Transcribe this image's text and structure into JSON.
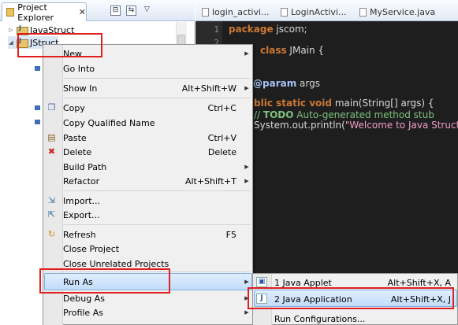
{
  "project_explorer": {
    "tab_label": "Project Explorer",
    "close_glyph": "✕",
    "projects": [
      {
        "name": "JavaStruct"
      },
      {
        "name": "JStruct"
      }
    ],
    "buttons": {
      "collapse": "⊟",
      "link": "⇆",
      "menu": "▽"
    }
  },
  "editor": {
    "tabs": [
      {
        "label": "login_activi..."
      },
      {
        "label": "LoginActivi..."
      },
      {
        "label": "MyService.java"
      }
    ],
    "line_numbers": [
      "1",
      "2"
    ],
    "code": {
      "line1_kw": "package",
      "line1_rest": " jscom;",
      "line2_kw": "class",
      "line2_rest": " JMain {",
      "line3_ann": "@param",
      "line3_rest": " args",
      "line4_kw": "blic static void",
      "line4_rest": " main(String[] args) {",
      "line5_cmt1": "// ",
      "line5_todo": "TODO",
      "line5_cmt2": " Auto-generated method stub",
      "line6_a": "System.out.println(",
      "line6_str": "\"Welcome to Java Struct!!"
    }
  },
  "context_menu": {
    "items": [
      {
        "label": "New",
        "accel": "",
        "submenu": true
      },
      {
        "label": "Go Into",
        "accel": ""
      },
      {
        "label": "Show In",
        "accel": "Alt+Shift+W",
        "submenu": true
      },
      {
        "label": "Copy",
        "accel": "Ctrl+C"
      },
      {
        "label": "Copy Qualified Name",
        "accel": ""
      },
      {
        "label": "Paste",
        "accel": "Ctrl+V"
      },
      {
        "label": "Delete",
        "accel": "Delete"
      },
      {
        "label": "Build Path",
        "accel": "",
        "submenu": true
      },
      {
        "label": "Refactor",
        "accel": "Alt+Shift+T",
        "submenu": true
      },
      {
        "label": "Import...",
        "accel": ""
      },
      {
        "label": "Export...",
        "accel": ""
      },
      {
        "label": "Refresh",
        "accel": "F5"
      },
      {
        "label": "Close Project",
        "accel": ""
      },
      {
        "label": "Close Unrelated Projects",
        "accel": ""
      },
      {
        "label": "Run As",
        "accel": "",
        "submenu": true
      },
      {
        "label": "Debug As",
        "accel": "",
        "submenu": true
      },
      {
        "label": "Profile As",
        "accel": "",
        "submenu": true
      }
    ]
  },
  "run_as_submenu": {
    "items": [
      {
        "label": "1 Java Applet",
        "accel": "Alt+Shift+X, A"
      },
      {
        "label": "2 Java Application",
        "accel": "Alt+Shift+X, J"
      },
      {
        "label": "Run Configurations...",
        "accel": ""
      }
    ]
  },
  "icons": {
    "submenu_arrow": "▶",
    "copy": "copy-icon",
    "paste": "paste-icon",
    "delete": "delete-icon",
    "import": "import-icon",
    "export": "export-icon",
    "refresh": "refresh-icon"
  },
  "colors": {
    "highlight": "#c3dcf8",
    "annotation_red": "#e02020",
    "editor_bg": "#1e1e1e"
  }
}
